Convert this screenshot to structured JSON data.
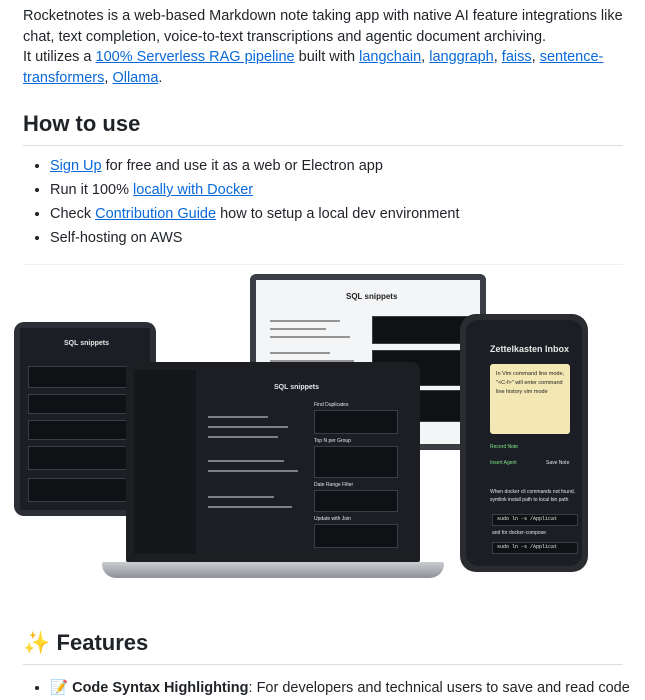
{
  "intro": {
    "line1": "Rocketnotes is a web-based Markdown note taking app with native AI feature integrations like chat, text completion, voice-to-text transcriptions and agentic document archiving.",
    "utilizes_prefix": "It utilizes a ",
    "rag_link": "100% Serverless RAG pipeline",
    "built_with": " built with ",
    "links": [
      "langchain",
      "langgraph",
      "faiss",
      "sentence-transformers",
      "Ollama"
    ]
  },
  "how_to_use": {
    "heading": "How to use",
    "items": [
      {
        "link": "Sign Up",
        "text": " for free and use it as a web or Electron app"
      },
      {
        "prefix": "Run it 100% ",
        "link": "locally with Docker"
      },
      {
        "prefix": "Check ",
        "link": "Contribution Guide",
        "text": " how to setup a local dev environment"
      },
      {
        "text": "Self-hosting on AWS"
      }
    ]
  },
  "screenshot": {
    "laptop_title": "SQL snippets",
    "tablet_title": "SQL snippets",
    "monitor_title": "SQL snippets",
    "phone_title": "Zettelkasten Inbox",
    "phone_note": "In Vim command line mode, \"<C-f>\" will enter command line history vim mode",
    "phone_buttons": [
      "Record Note",
      "Insert Agent",
      "Save Note"
    ],
    "phone_text": "When docker cli commands not found, symlink install path to local bin path",
    "phone_cmd1": "sudo ln -s /Applicat",
    "phone_cmd_label": "and for docker-compose",
    "phone_cmd2": "sudo ln -s /Applicat",
    "laptop_headings": [
      "Find Duplicates",
      "Top N per Group",
      "Date Range Filter",
      "Update with Join"
    ]
  },
  "features": {
    "heading": "Features",
    "heading_emoji": "✨",
    "item_emoji": "📝",
    "item_bold": "Code Syntax Highlighting",
    "item_text": ": For developers and technical users to save and read code"
  }
}
